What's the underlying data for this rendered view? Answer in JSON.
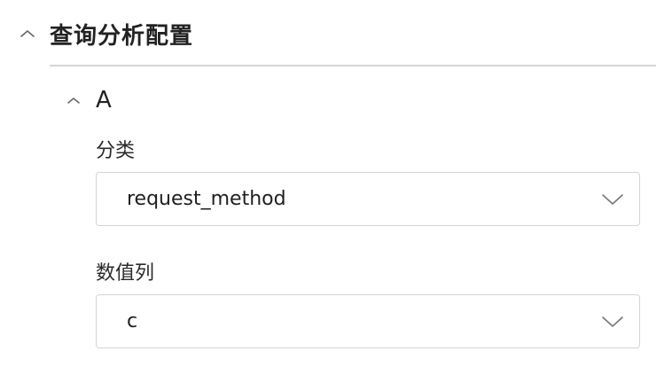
{
  "section": {
    "title": "查询分析配置",
    "expanded": true
  },
  "group": {
    "title": "A",
    "expanded": true
  },
  "fields": {
    "category": {
      "label": "分类",
      "value": "request_method"
    },
    "value_column": {
      "label": "数值列",
      "value": "c"
    }
  },
  "icons": {
    "collapse": "chevron-up-icon",
    "dropdown": "chevron-down-icon"
  }
}
